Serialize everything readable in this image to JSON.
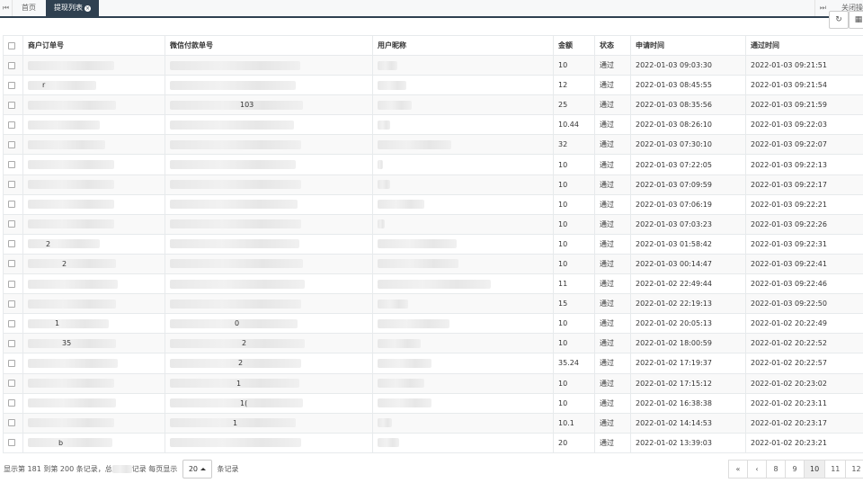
{
  "tabs": {
    "home": "首页",
    "active": "提现列表",
    "close_all": "关闭操作"
  },
  "columns": [
    "商户订单号",
    "微信付款单号",
    "用户昵称",
    "金额",
    "状态",
    "申请时间",
    "通过时间"
  ],
  "rows": [
    {
      "order_fragment": "",
      "pay_fragment": "",
      "amount": "10",
      "status": "通过",
      "applied": "2022-01-03 09:03:30",
      "approved": "2022-01-03 09:21:51"
    },
    {
      "order_fragment": "r",
      "pay_fragment": "",
      "amount": "12",
      "status": "通过",
      "applied": "2022-01-03 08:45:55",
      "approved": "2022-01-03 09:21:54"
    },
    {
      "order_fragment": "",
      "pay_fragment": "103",
      "amount": "25",
      "status": "通过",
      "applied": "2022-01-03 08:35:56",
      "approved": "2022-01-03 09:21:59"
    },
    {
      "order_fragment": "",
      "pay_fragment": "",
      "amount": "10.44",
      "status": "通过",
      "applied": "2022-01-03 08:26:10",
      "approved": "2022-01-03 09:22:03"
    },
    {
      "order_fragment": "",
      "pay_fragment": "",
      "amount": "32",
      "status": "通过",
      "applied": "2022-01-03 07:30:10",
      "approved": "2022-01-03 09:22:07"
    },
    {
      "order_fragment": "",
      "pay_fragment": "",
      "amount": "10",
      "status": "通过",
      "applied": "2022-01-03 07:22:05",
      "approved": "2022-01-03 09:22:13"
    },
    {
      "order_fragment": "",
      "pay_fragment": "",
      "amount": "10",
      "status": "通过",
      "applied": "2022-01-03 07:09:59",
      "approved": "2022-01-03 09:22:17"
    },
    {
      "order_fragment": "",
      "pay_fragment": "",
      "amount": "10",
      "status": "通过",
      "applied": "2022-01-03 07:06:19",
      "approved": "2022-01-03 09:22:21"
    },
    {
      "order_fragment": "",
      "pay_fragment": "",
      "amount": "10",
      "status": "通过",
      "applied": "2022-01-03 07:03:23",
      "approved": "2022-01-03 09:22:26"
    },
    {
      "order_fragment": "2",
      "pay_fragment": "",
      "amount": "10",
      "status": "通过",
      "applied": "2022-01-03 01:58:42",
      "approved": "2022-01-03 09:22:31"
    },
    {
      "order_fragment": "2",
      "pay_fragment": "",
      "amount": "10",
      "status": "通过",
      "applied": "2022-01-03 00:14:47",
      "approved": "2022-01-03 09:22:41"
    },
    {
      "order_fragment": "",
      "pay_fragment": "",
      "amount": "11",
      "status": "通过",
      "applied": "2022-01-02 22:49:44",
      "approved": "2022-01-03 09:22:46"
    },
    {
      "order_fragment": "",
      "pay_fragment": "",
      "amount": "15",
      "status": "通过",
      "applied": "2022-01-02 22:19:13",
      "approved": "2022-01-03 09:22:50"
    },
    {
      "order_fragment": "1",
      "pay_fragment": "0",
      "amount": "10",
      "status": "通过",
      "applied": "2022-01-02 20:05:13",
      "approved": "2022-01-02 20:22:49"
    },
    {
      "order_fragment": "35",
      "pay_fragment": "2",
      "amount": "10",
      "status": "通过",
      "applied": "2022-01-02 18:00:59",
      "approved": "2022-01-02 20:22:52"
    },
    {
      "order_fragment": "",
      "pay_fragment": "2",
      "amount": "35.24",
      "status": "通过",
      "applied": "2022-01-02 17:19:37",
      "approved": "2022-01-02 20:22:57"
    },
    {
      "order_fragment": "",
      "pay_fragment": "1",
      "amount": "10",
      "status": "通过",
      "applied": "2022-01-02 17:15:12",
      "approved": "2022-01-02 20:23:02"
    },
    {
      "order_fragment": "",
      "pay_fragment": "1(",
      "amount": "10",
      "status": "通过",
      "applied": "2022-01-02 16:38:38",
      "approved": "2022-01-02 20:23:11"
    },
    {
      "order_fragment": "",
      "pay_fragment": "1",
      "amount": "10.1",
      "status": "通过",
      "applied": "2022-01-02 14:14:53",
      "approved": "2022-01-02 20:23:17"
    },
    {
      "order_fragment": "b",
      "pay_fragment": "",
      "amount": "20",
      "status": "通过",
      "applied": "2022-01-02 13:39:03",
      "approved": "2022-01-02 20:23:21"
    }
  ],
  "footer": {
    "summary_prefix": "显示第 181 到第 200 条记录，总",
    "summary_suffix": "记录 每页显示",
    "page_size": "20",
    "page_size_suffix": "条记录"
  },
  "pagination": {
    "first": "«",
    "prev": "‹",
    "pages": [
      "8",
      "9",
      "10",
      "11",
      "12"
    ],
    "current": "10"
  }
}
